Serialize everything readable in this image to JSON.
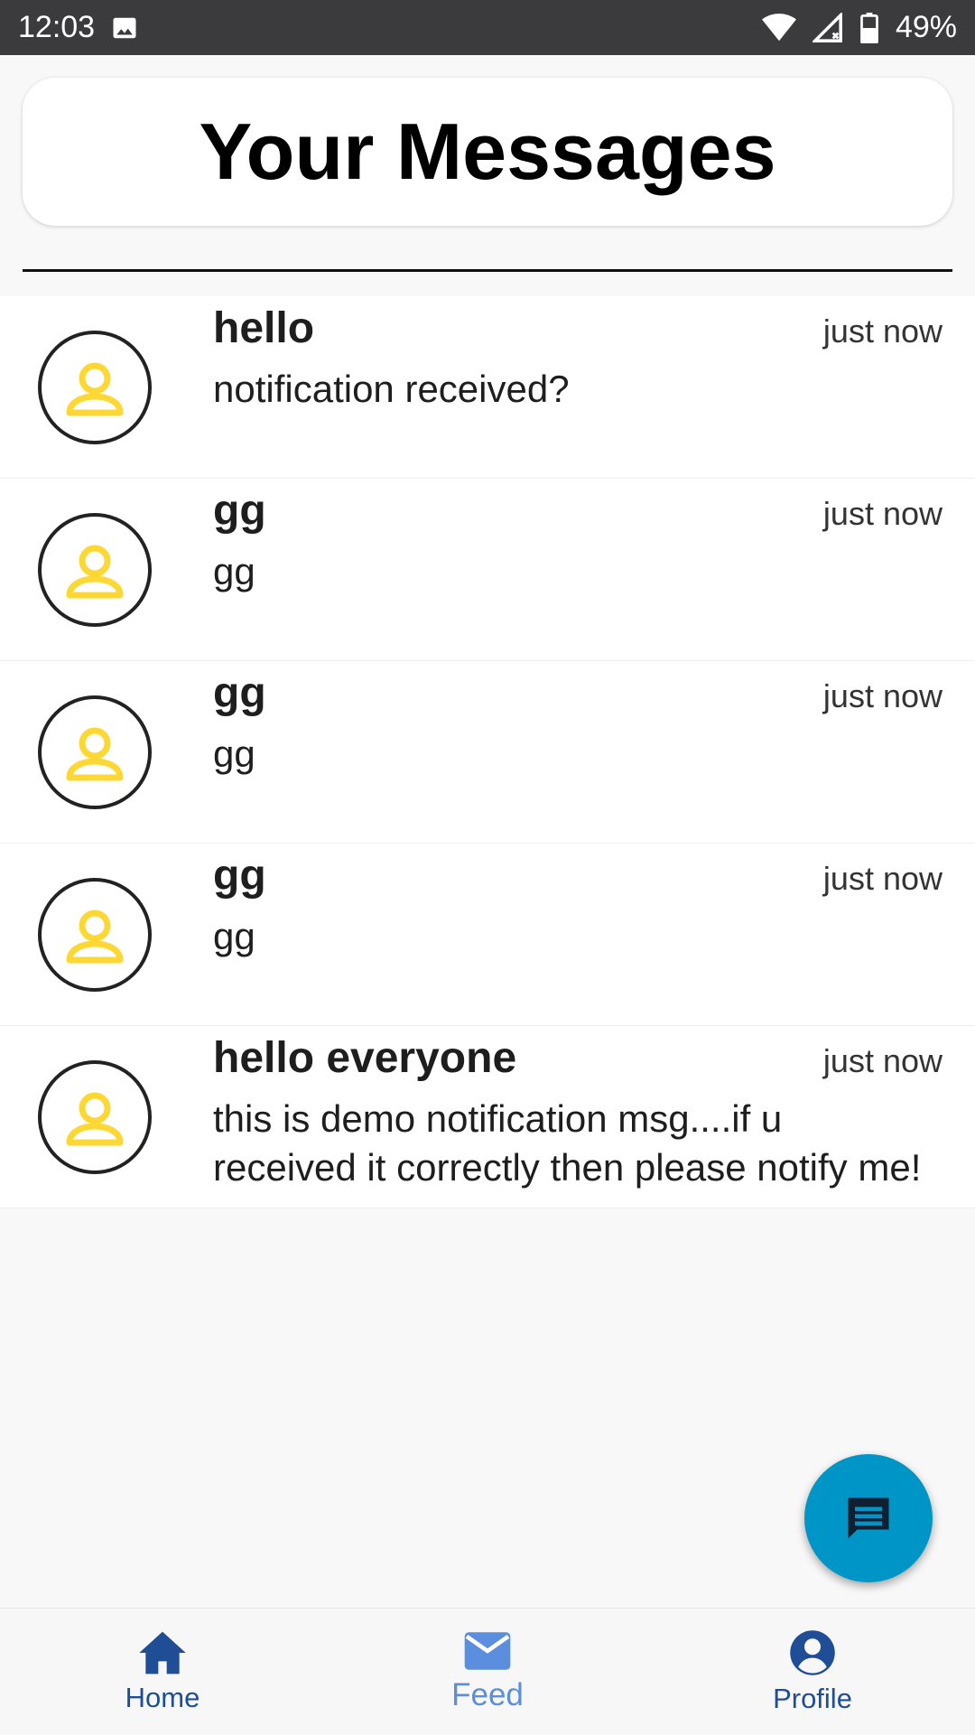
{
  "status_bar": {
    "time": "12:03",
    "battery": "49%",
    "icons": [
      "image-icon",
      "wifi-icon",
      "signal-icon",
      "battery-icon"
    ]
  },
  "header": {
    "title": "Your Messages"
  },
  "messages": [
    {
      "title": "hello",
      "time": "just now",
      "body": "notification received?",
      "avatar": "person-icon"
    },
    {
      "title": "gg",
      "time": "just now",
      "body": "gg",
      "avatar": "person-icon"
    },
    {
      "title": "gg",
      "time": "just now",
      "body": "gg",
      "avatar": "person-icon"
    },
    {
      "title": "gg",
      "time": "just now",
      "body": "gg",
      "avatar": "person-icon"
    },
    {
      "title": "hello everyone",
      "time": "just now",
      "body": "this is demo notification msg....if u received it correctly then please notify me!",
      "avatar": "person-icon"
    }
  ],
  "fab": {
    "icon": "chat-icon"
  },
  "bottom_nav": {
    "items": [
      {
        "label": "Home",
        "icon": "home-icon",
        "active": false
      },
      {
        "label": "Feed",
        "icon": "mail-icon",
        "active": true
      },
      {
        "label": "Profile",
        "icon": "account-circle-icon",
        "active": false
      }
    ]
  },
  "colors": {
    "status_bar": "#3b3a3c",
    "avatar_accent": "#fdd835",
    "fab": "#0095c7",
    "nav_inactive": "#1f4e96",
    "nav_active": "#5b8ede"
  }
}
